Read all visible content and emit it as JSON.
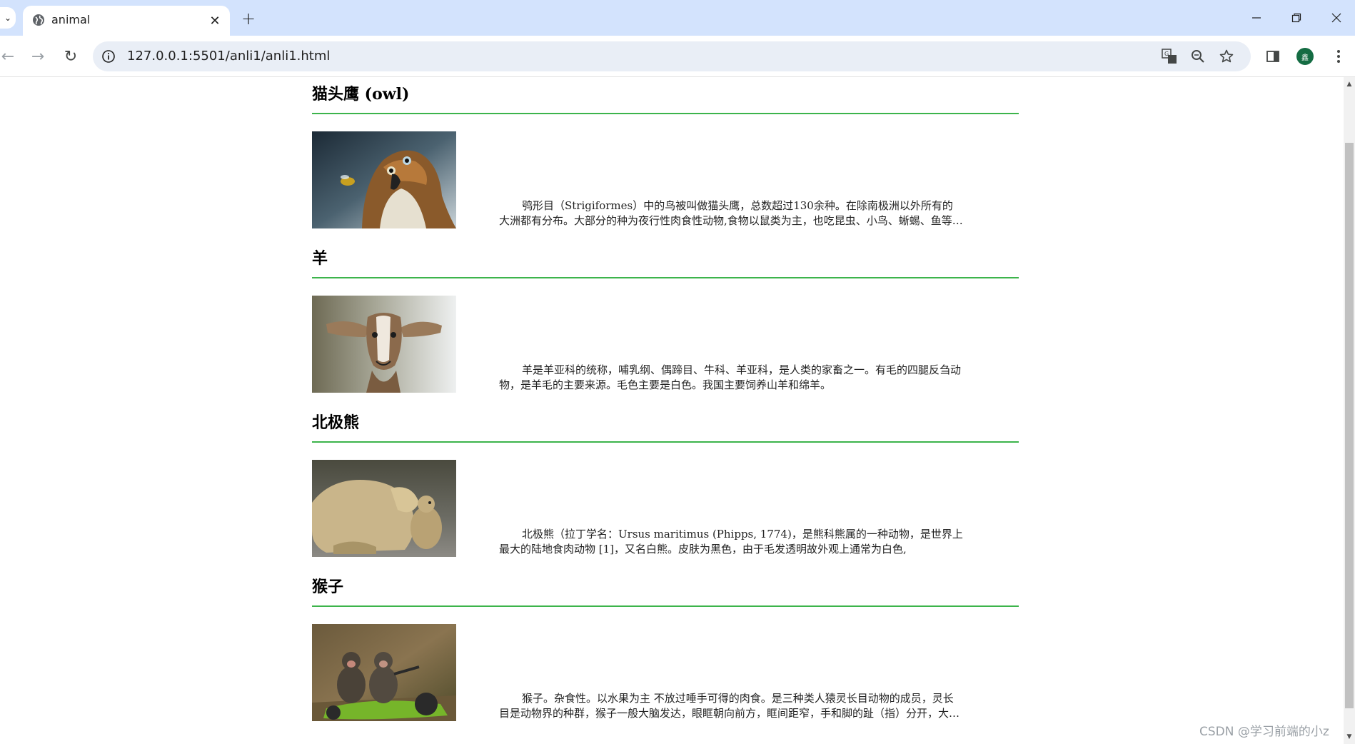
{
  "browser": {
    "tab_title": "animal",
    "url": "127.0.0.1:5501/anli1/anli1.html",
    "avatar_initial": "鑫"
  },
  "animals": [
    {
      "title": "猫头鹰 (owl)",
      "desc": "鸮形目（Strigiformes）中的鸟被叫做猫头鹰，总数超过130余种。在除南极洲以外所有的大洲都有分布。大部分的种为夜行性肉食性动物,食物以鼠类为主，也吃昆虫、小鸟、蜥蜴、鱼等动物。",
      "image": "owl-bird-photo"
    },
    {
      "title": "羊",
      "desc": "羊是羊亚科的统称，哺乳纲、偶蹄目、牛科、羊亚科，是人类的家畜之一。有毛的四腿反刍动物，是羊毛的主要来源。毛色主要是白色。我国主要饲养山羊和绵羊。",
      "image": "goat-photo"
    },
    {
      "title": "北极熊",
      "desc": "北极熊（拉丁学名：Ursus maritimus (Phipps, 1774)，是熊科熊属的一种动物，是世界上最大的陆地食肉动物 [1]，又名白熊。皮肤为黑色，由于毛发透明故外观上通常为白色,",
      "image": "polar-bear-photo"
    },
    {
      "title": "猴子",
      "desc": "猴子。杂食性。以水果为主 不放过唾手可得的肉食。是三种类人猿灵长目动物的成员，灵长目是动物界的种群，猴子一般大脑发达，眼眶朝向前方，眶间距窄，手和脚的趾（指）分开，大拇指灵活。",
      "image": "monkeys-photo"
    }
  ],
  "watermark": "CSDN @学习前端的小z",
  "colors": {
    "rule": "#3cb44b",
    "tabbar": "#d3e3fd",
    "omnibox": "#e9eef6"
  }
}
